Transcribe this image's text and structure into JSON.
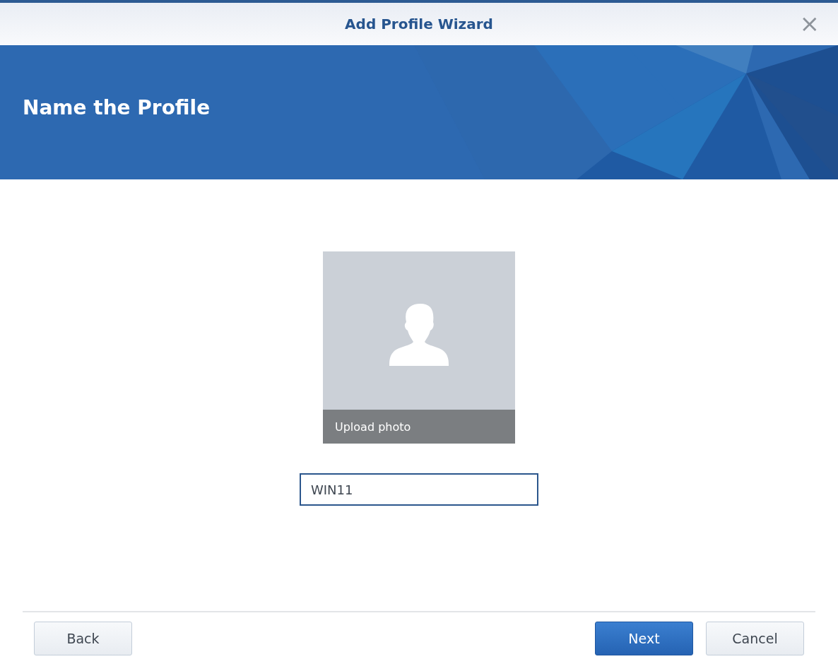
{
  "window": {
    "title": "Add Profile Wizard",
    "close": "×"
  },
  "banner": {
    "title": "Name the Profile"
  },
  "photo": {
    "upload_label": "Upload photo"
  },
  "name_field": {
    "value": "WIN11"
  },
  "buttons": [
    {
      "label": "Back",
      "kind": "default"
    },
    {
      "label": "Next",
      "kind": "primary"
    },
    {
      "label": "Cancel",
      "kind": "default"
    }
  ]
}
